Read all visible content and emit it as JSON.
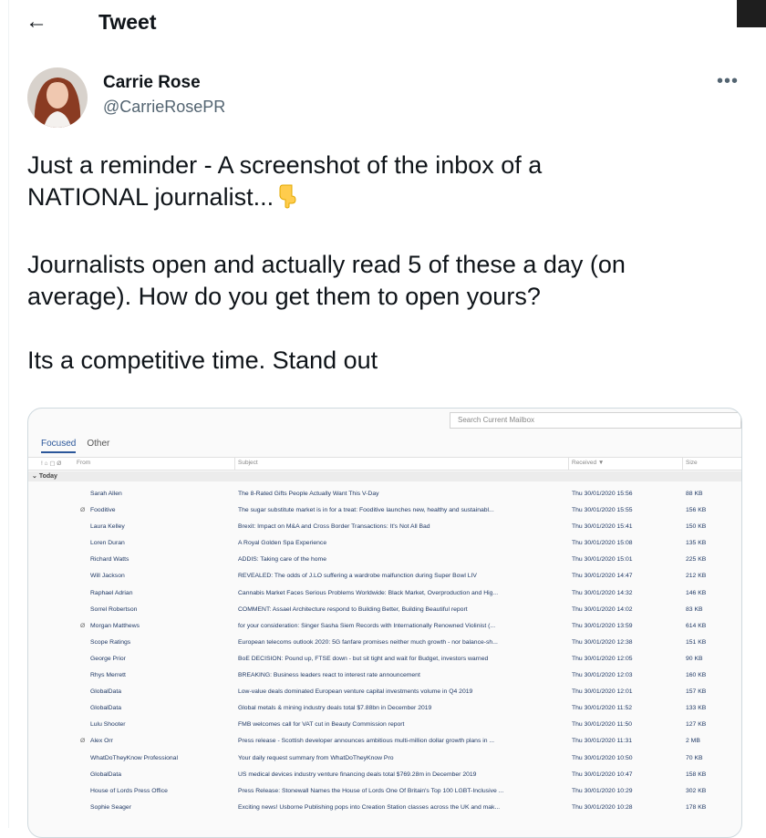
{
  "header": {
    "back_icon": "arrow-left-icon",
    "title": "Tweet"
  },
  "author": {
    "name": "Carrie Rose",
    "handle": "@CarrieRosePR"
  },
  "more_icon": "more-dots-icon",
  "tweet": {
    "line1": "Just a reminder - A screenshot of the inbox of a NATIONAL journalist...",
    "emoji_icon": "pointing-down-icon",
    "line2": "Journalists open and actually read 5 of these a day (on average). How do you get them to open yours?",
    "line3": "Its a competitive time. Stand out"
  },
  "mail": {
    "search_placeholder": "Search Current Mailbox",
    "tabs": [
      "Focused",
      "Other"
    ],
    "columns": {
      "icons": "! ⌂ ▢ Ø",
      "from": "From",
      "subject": "Subject",
      "received": "Received ▼",
      "size": "Size"
    },
    "group": "Today",
    "rows": [
      {
        "attach": "",
        "from": "Sarah Allen",
        "subject": "The 8-Rated Gifts People Actually Want This V-Day",
        "received": "Thu 30/01/2020 15:56",
        "size": "88 KB"
      },
      {
        "attach": "Ø",
        "from": "Fooditive",
        "subject": "The sugar substitute market is in for a treat: Fooditive launches new, healthy and sustainabl...",
        "received": "Thu 30/01/2020 15:55",
        "size": "156 KB"
      },
      {
        "attach": "",
        "from": "Laura Kelley",
        "subject": "Brexit: Impact on M&A and Cross Border Transactions: It's Not All Bad",
        "received": "Thu 30/01/2020 15:41",
        "size": "150 KB"
      },
      {
        "attach": "",
        "from": "Loren Duran",
        "subject": "A Royal Golden Spa Experience",
        "received": "Thu 30/01/2020 15:08",
        "size": "135 KB"
      },
      {
        "attach": "",
        "from": "Richard Watts",
        "subject": "ADDIS: Taking care of the home",
        "received": "Thu 30/01/2020 15:01",
        "size": "225 KB"
      },
      {
        "attach": "",
        "from": "Will Jackson",
        "subject": "REVEALED: The odds of J.LO suffering a wardrobe malfunction during Super Bowl LIV",
        "received": "Thu 30/01/2020 14:47",
        "size": "212 KB"
      },
      {
        "attach": "",
        "from": "Raphael Adrian",
        "subject": "Cannabis Market Faces Serious Problems Worldwide: Black Market, Overproduction and Hig...",
        "received": "Thu 30/01/2020 14:32",
        "size": "146 KB"
      },
      {
        "attach": "",
        "from": "Sorrel Robertson",
        "subject": "COMMENT: Assael Architecture respond to Building Better, Building Beautiful report",
        "received": "Thu 30/01/2020 14:02",
        "size": "83 KB"
      },
      {
        "attach": "Ø",
        "from": "Morgan Matthews",
        "subject": "for your consideration: Singer Sasha Siem Records with Internationally Renowned Violinist (...",
        "received": "Thu 30/01/2020 13:59",
        "size": "614 KB"
      },
      {
        "attach": "",
        "from": "Scope Ratings",
        "subject": "European telecoms outlook 2020: 5G fanfare promises neither much growth - nor balance-sh...",
        "received": "Thu 30/01/2020 12:38",
        "size": "151 KB"
      },
      {
        "attach": "",
        "from": "George Prior",
        "subject": "BoE DECISION: Pound up, FTSE down - but sit tight and wait for Budget, investors warned",
        "received": "Thu 30/01/2020 12:05",
        "size": "90 KB"
      },
      {
        "attach": "",
        "from": "Rhys Merrett",
        "subject": "BREAKING: Business leaders react to interest rate announcement",
        "received": "Thu 30/01/2020 12:03",
        "size": "160 KB"
      },
      {
        "attach": "",
        "from": "GlobalData",
        "subject": "Low-value deals dominated European venture capital investments volume in Q4 2019",
        "received": "Thu 30/01/2020 12:01",
        "size": "157 KB"
      },
      {
        "attach": "",
        "from": "GlobalData",
        "subject": "Global metals & mining industry deals total $7.88bn in December 2019",
        "received": "Thu 30/01/2020 11:52",
        "size": "133 KB"
      },
      {
        "attach": "",
        "from": "Lulu Shooter",
        "subject": "FMB welcomes call for VAT cut in Beauty Commission report",
        "received": "Thu 30/01/2020 11:50",
        "size": "127 KB"
      },
      {
        "attach": "Ø",
        "from": "Alex Orr",
        "subject": "Press release - Scottish developer announces ambitious multi-million dollar growth plans in ...",
        "received": "Thu 30/01/2020 11:31",
        "size": "2 MB"
      },
      {
        "attach": "",
        "from": "WhatDoTheyKnow Professional",
        "subject": "Your daily request summary from WhatDoTheyKnow Pro",
        "received": "Thu 30/01/2020 10:50",
        "size": "70 KB"
      },
      {
        "attach": "",
        "from": "GlobalData",
        "subject": "US medical devices industry venture financing deals total $769.28m in December 2019",
        "received": "Thu 30/01/2020 10:47",
        "size": "158 KB"
      },
      {
        "attach": "",
        "from": "House of Lords Press Office",
        "subject": "Press Release: Stonewall Names the House of Lords One Of Britain's Top 100 LGBT-Inclusive ...",
        "received": "Thu 30/01/2020 10:29",
        "size": "302 KB"
      },
      {
        "attach": "",
        "from": "Sophie Seager",
        "subject": "Exciting news! Usborne Publishing pops into Creation Station classes across the UK and mak...",
        "received": "Thu 30/01/2020 10:28",
        "size": "178 KB"
      }
    ]
  }
}
